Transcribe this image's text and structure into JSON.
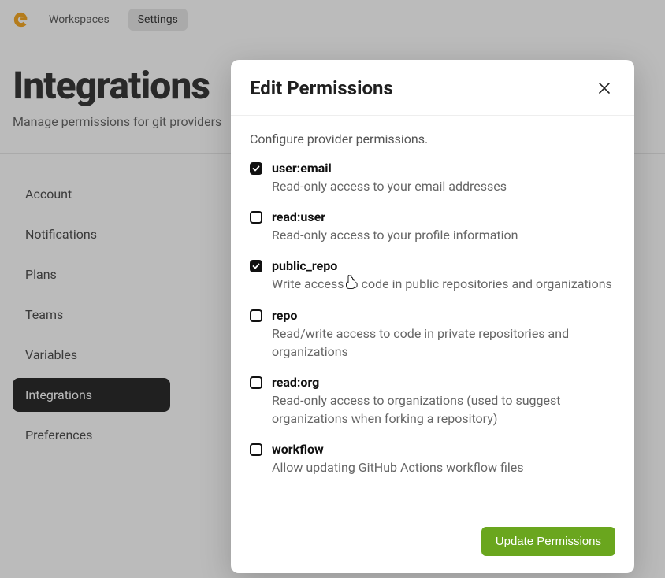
{
  "nav": {
    "workspaces": "Workspaces",
    "settings": "Settings"
  },
  "page": {
    "title": "Integrations",
    "subtitle": "Manage permissions for git providers"
  },
  "sidebar": {
    "items": [
      {
        "label": "Account"
      },
      {
        "label": "Notifications"
      },
      {
        "label": "Plans"
      },
      {
        "label": "Teams"
      },
      {
        "label": "Variables"
      },
      {
        "label": "Integrations"
      },
      {
        "label": "Preferences"
      }
    ]
  },
  "modal": {
    "title": "Edit Permissions",
    "description": "Configure provider permissions.",
    "update_label": "Update Permissions",
    "permissions": [
      {
        "name": "user:email",
        "desc": "Read-only access to your email addresses",
        "checked": true
      },
      {
        "name": "read:user",
        "desc": "Read-only access to your profile information",
        "checked": false
      },
      {
        "name": "public_repo",
        "desc": "Write access to code in public repositories and organizations",
        "checked": true
      },
      {
        "name": "repo",
        "desc": "Read/write access to code in private repositories and organizations",
        "checked": false
      },
      {
        "name": "read:org",
        "desc": "Read-only access to organizations (used to suggest organizations when forking a repository)",
        "checked": false
      },
      {
        "name": "workflow",
        "desc": "Allow updating GitHub Actions workflow files",
        "checked": false
      }
    ]
  }
}
